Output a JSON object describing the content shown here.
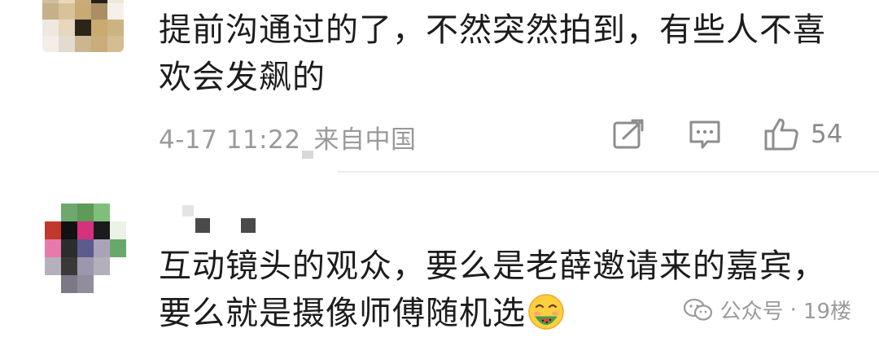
{
  "comments": [
    {
      "text_lines": [
        "提前沟通过的了，不然突然拍到，有些人不喜",
        "欢会发飙的"
      ],
      "time": "4-17 11:22",
      "location": "来自中国",
      "like_count": "54",
      "icons": {
        "share": "share-icon",
        "reply": "comment-icon",
        "like": "thumbs-up-icon"
      }
    },
    {
      "text_lines": [
        "互动镜头的观众，要么是老薛邀请来的嘉宾，",
        "要么就是摄像师傅随机选"
      ],
      "emoji": "smiling-face-eating-watermelon-icon"
    }
  ],
  "watermark": {
    "source": "公众号",
    "separator": "·",
    "floor": "19楼",
    "icon": "wechat-icon"
  },
  "colors": {
    "text": "#1c1c1c",
    "meta": "#9a9a9a",
    "divider": "#ececec"
  }
}
